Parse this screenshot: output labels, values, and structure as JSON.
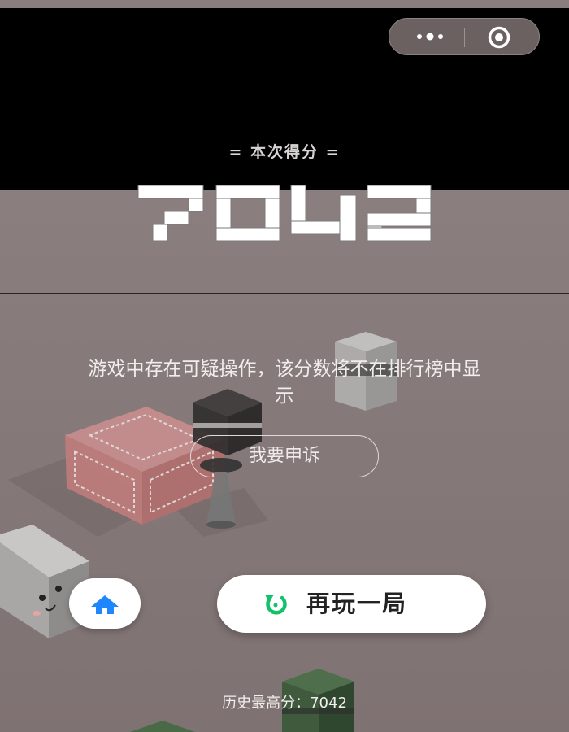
{
  "header": {
    "score_label": "= 本次得分 =",
    "score": "7042"
  },
  "capsule": {
    "more_icon": "more-dots-icon",
    "close_icon": "target-circle-icon"
  },
  "notice": {
    "message": "游戏中存在可疑操作，该分数将不在排行榜中显示",
    "appeal_button": "我要申诉"
  },
  "actions": {
    "home_icon": "home-icon",
    "replay_icon": "replay-icon",
    "replay_label": "再玩一局"
  },
  "footer": {
    "best_score": "历史最高分：7042"
  },
  "colors": {
    "background": "#877a7a",
    "home_icon": "#1e86ff",
    "replay_icon": "#12c26a"
  }
}
